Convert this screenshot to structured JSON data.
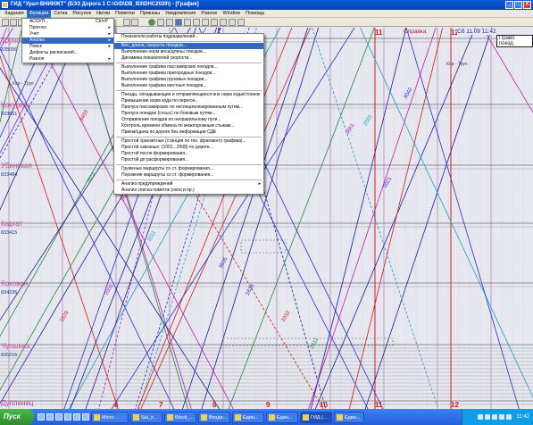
{
  "window": {
    "title": "ГИД \"Урал-ВНИИЖТ\" (БЭЗ Дорога 1 С:\\GID\\DB_B3\\DHC2020\\) - [График]",
    "buttons": [
      "_",
      "□",
      "×"
    ]
  },
  "menubar": {
    "items": [
      "Задания",
      "Функции",
      "Сетка",
      "Рисунок",
      "Нитки",
      "Пометки",
      "Приказы",
      "Уведомления",
      "Разное",
      "Window",
      "Помощь"
    ],
    "active_index": 1
  },
  "functions_menu": {
    "items": [
      {
        "label": "АСОУП...",
        "shortcut": "Ctrl+P",
        "submenu": false,
        "highlighted": false
      },
      {
        "label": "Прогноз",
        "shortcut": "",
        "submenu": true,
        "highlighted": false
      },
      {
        "label": "Учет",
        "shortcut": "",
        "submenu": true,
        "highlighted": false
      },
      {
        "label": "Анализ",
        "shortcut": "",
        "submenu": true,
        "highlighted": true
      },
      {
        "label": "Поиск",
        "shortcut": "",
        "submenu": true,
        "highlighted": false
      },
      {
        "label": "Дефекты расписаний...",
        "shortcut": "",
        "submenu": false,
        "highlighted": false
      },
      {
        "label": "Разное",
        "shortcut": "",
        "submenu": true,
        "highlighted": false
      }
    ]
  },
  "analysis_menu": {
    "groups": [
      [
        {
          "label": "Показатели работы подразделений...",
          "highlighted": false
        }
      ],
      [
        {
          "label": "Вес, длина, скорость поездов...",
          "highlighted": true
        },
        {
          "label": "Выполнение норм веса/длины поездов...",
          "highlighted": false
        },
        {
          "label": "Динамика показателей скорости...",
          "highlighted": false
        }
      ],
      [
        {
          "label": "Выполнение графика пассажирских поездов...",
          "highlighted": false
        },
        {
          "label": "Выполнение графика пригородных поездов...",
          "highlighted": false
        },
        {
          "label": "Выполнение графика грузовых поездов...",
          "highlighted": false
        },
        {
          "label": "Выполнение графика местных поездов...",
          "highlighted": false
        }
      ],
      [
        {
          "label": "Поезда, опоздывающие и отправляющиеся вне норм хода/стоянок",
          "highlighted": false
        },
        {
          "label": "Превышение норм хода по перегон...",
          "highlighted": false
        },
        {
          "label": "Пропуск пассажирских по неспециализированным путям...",
          "highlighted": false
        },
        {
          "label": "Пропуск поездов (сосыс) по боковым путям...",
          "highlighted": false
        },
        {
          "label": "Отправление поездов по неправильному пути...",
          "highlighted": false
        },
        {
          "label": "Контроль времени обмена по межлорожным стыкам...",
          "highlighted": false
        },
        {
          "label": "Прием/сдача по дороге без информации СДЕ",
          "highlighted": false
        }
      ],
      [
        {
          "label": "Простой транзитных (станция по тех. фрагменту графика)...",
          "highlighted": false
        },
        {
          "label": "Простой сквозных: (1001...2998) по дороге...",
          "highlighted": false
        },
        {
          "label": "Простой после формирования...",
          "highlighted": false
        },
        {
          "label": "Простой до расформирования...",
          "highlighted": false
        }
      ],
      [
        {
          "label": "Груженые маршруты со ст. формирования...",
          "highlighted": false
        },
        {
          "label": "Порожние маршруты со ст. формирования...",
          "highlighted": false
        }
      ],
      [
        {
          "label": "Анализ предупреждений",
          "highlighted": false,
          "submenu": true
        },
        {
          "label": "Анализ списка пометок (окон и пр.)",
          "highlighted": false
        }
      ]
    ]
  },
  "graph": {
    "stations": [
      {
        "name": "Труновь",
        "code": "835056"
      },
      {
        "name": "Кокурка",
        "code": "833661"
      },
      {
        "name": "Убинская",
        "code": "833484"
      },
      {
        "name": "Каргат",
        "code": "833415"
      },
      {
        "name": "Кокован",
        "code": "834236"
      },
      {
        "name": "Чулымск",
        "code": "835216"
      },
      {
        "name": "Дупленец",
        "code": ""
      }
    ],
    "hours_top": [
      "11",
      "12"
    ],
    "hours_bottom": [
      "6",
      "7",
      "8",
      "9",
      "10",
      "11",
      "12"
    ],
    "spravka": "Справка",
    "date_label": "Сб 11.09 11:42",
    "right_box": "Право поезд",
    "track_label": "Кор - Труп",
    "train_numbers": [
      "2041",
      "3403",
      "2823",
      "1641",
      "2011",
      "3605",
      "1634",
      "2032",
      "2411",
      "3861",
      "2501",
      "2021",
      "3042",
      "1629",
      "2031",
      "2005"
    ]
  },
  "taskbar": {
    "start_label": "Пуск",
    "tasks": [
      "Micro...",
      "Sai_n...",
      "Block_...",
      "Входя...",
      "Един...",
      "Един...",
      "ГИД (...",
      "Един..."
    ],
    "active_task": 6,
    "clock": "11:42"
  }
}
